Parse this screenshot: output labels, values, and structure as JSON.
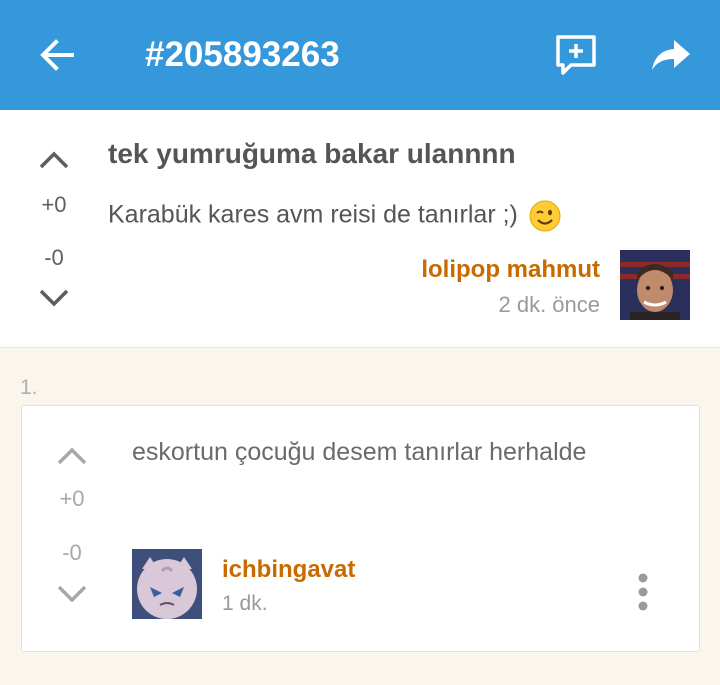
{
  "appbar": {
    "title": "#205893263",
    "back_icon": "arrow-back-icon",
    "add_icon": "add-comment-icon",
    "share_icon": "share-icon",
    "color": "#3498db"
  },
  "post": {
    "title": "tek yumruğuma bakar ulannnn",
    "body": "Karabük kares avm reisi de tanırlar ;)",
    "emoji": "winking-face",
    "upvotes": "+0",
    "downvotes": "-0",
    "author": "lolipop mahmut",
    "time": "2 dk. önce"
  },
  "comments": [
    {
      "index": "1.",
      "text": "eskortun çocuğu desem tanırlar herhalde",
      "upvotes": "+0",
      "downvotes": "-0",
      "author": "ichbingavat",
      "time": "1 dk."
    }
  ],
  "colors": {
    "author": "#c96a00",
    "background": "#faf6ee"
  }
}
